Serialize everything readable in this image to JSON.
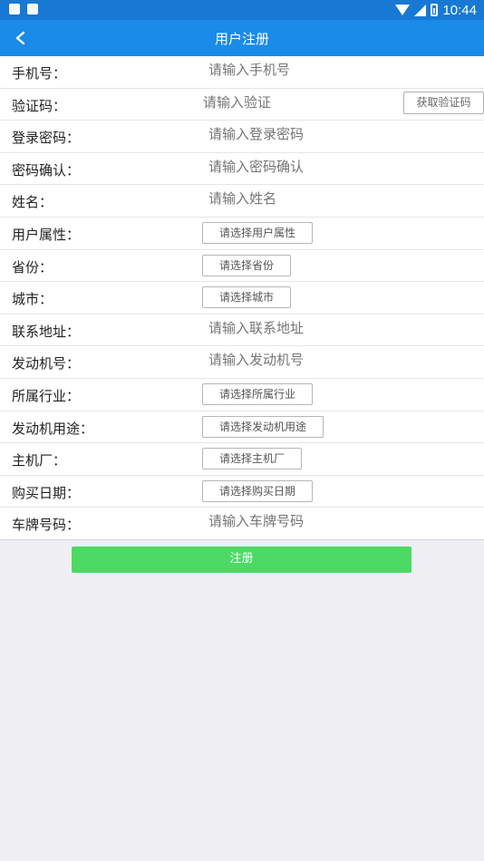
{
  "status_bar": {
    "time": "10:44",
    "left_icons": [
      "android-icon",
      "app-icon"
    ],
    "right_icons": [
      "wifi-icon",
      "signal-icon",
      "battery-icon"
    ]
  },
  "nav": {
    "title": "用户注册",
    "back_icon": "chevron-left-icon"
  },
  "form": {
    "rows": [
      {
        "label": "手机号：",
        "type": "input",
        "placeholder": "请输入手机号"
      },
      {
        "label": "验证码：",
        "type": "code",
        "placeholder": "请输入验证",
        "button": "获取验证码"
      },
      {
        "label": "登录密码：",
        "type": "input",
        "placeholder": "请输入登录密码"
      },
      {
        "label": "密码确认：",
        "type": "input",
        "placeholder": "请输入密码确认"
      },
      {
        "label": "姓名：",
        "type": "input",
        "placeholder": "请输入姓名"
      },
      {
        "label": "用户属性：",
        "type": "select",
        "button": "请选择用户属性"
      },
      {
        "label": "省份：",
        "type": "select",
        "button": "请选择省份"
      },
      {
        "label": "城市：",
        "type": "select",
        "button": "请选择城市"
      },
      {
        "label": "联系地址：",
        "type": "input",
        "placeholder": "请输入联系地址"
      },
      {
        "label": "发动机号：",
        "type": "input",
        "placeholder": "请输入发动机号"
      },
      {
        "label": "所属行业：",
        "type": "select",
        "button": "请选择所属行业"
      },
      {
        "label": "发动机用途：",
        "type": "select",
        "button": "请选择发动机用途"
      },
      {
        "label": "主机厂：",
        "type": "select",
        "button": "请选择主机厂"
      },
      {
        "label": "购买日期：",
        "type": "select",
        "button": "请选择购买日期"
      },
      {
        "label": "车牌号码：",
        "type": "input",
        "placeholder": "请输入车牌号码"
      }
    ]
  },
  "register_button": "注册",
  "colors": {
    "status_bar": "#1779d4",
    "nav_bar": "#1a8be8",
    "register": "#4cd964",
    "background": "#efeff4"
  }
}
